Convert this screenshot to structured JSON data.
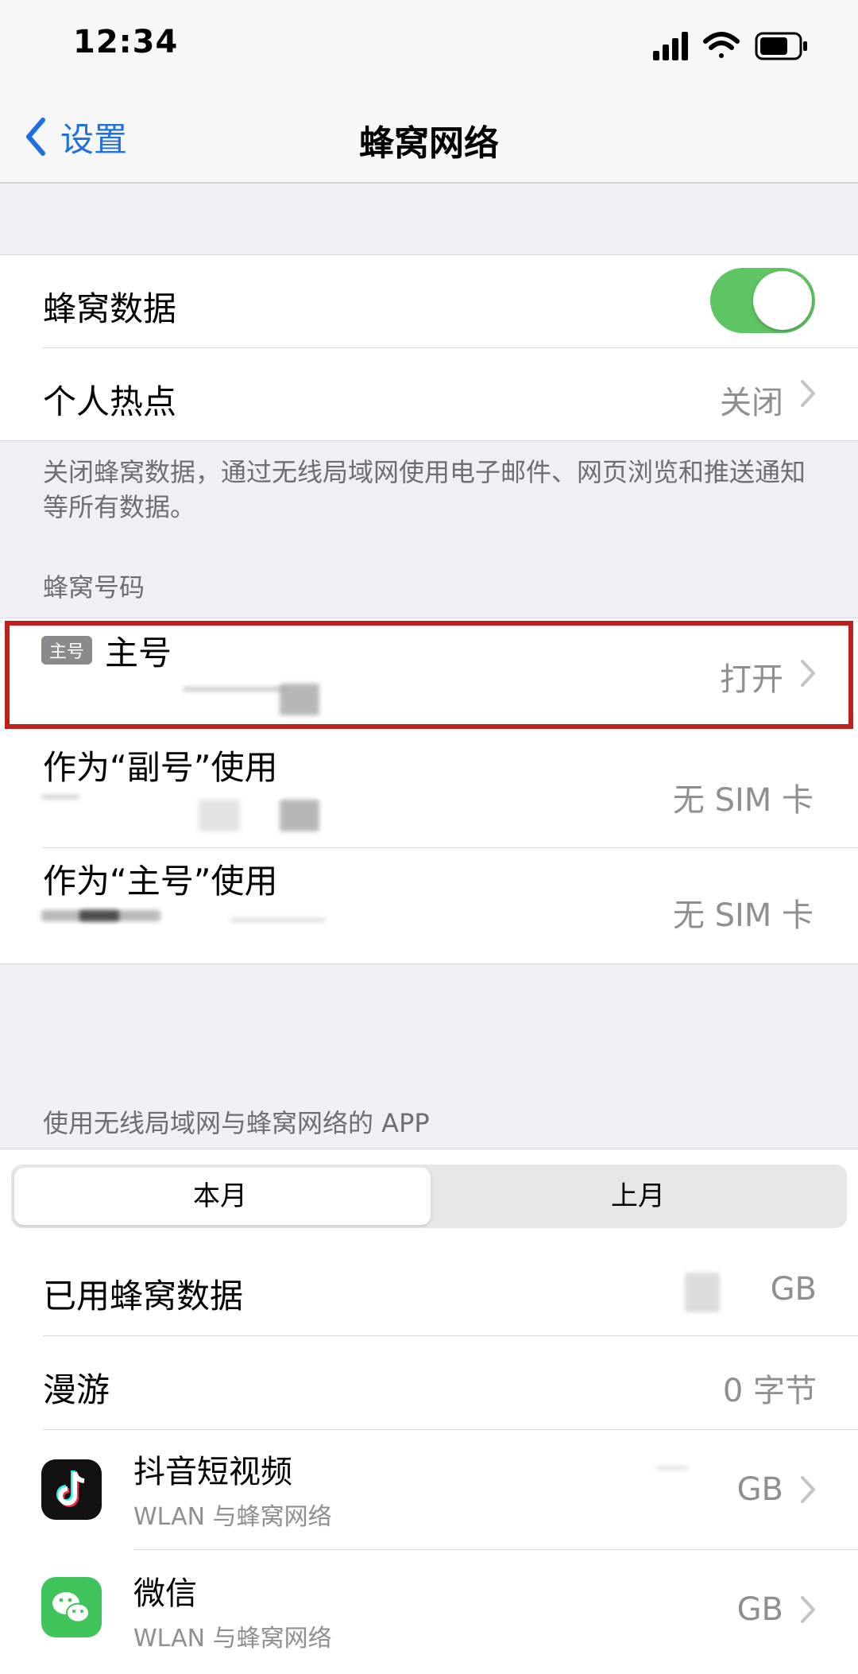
{
  "status_bar": {
    "time": "12:34"
  },
  "nav": {
    "back_label": "设置",
    "title": "蜂窝网络"
  },
  "group1": {
    "cellular_data_label": "蜂窝数据",
    "cellular_data_on": true,
    "hotspot_label": "个人热点",
    "hotspot_value": "关闭"
  },
  "footnote": "关闭蜂窝数据，通过无线局域网使用电子邮件、网页浏览和推送通知等所有数据。",
  "numbers_section": {
    "header": "蜂窝号码",
    "primary": {
      "badge": "主号",
      "label": "主号",
      "value": "打开"
    },
    "as_secondary": {
      "label": "作为“副号”使用",
      "value": "无 SIM 卡"
    },
    "as_primary": {
      "label": "作为“主号”使用",
      "value": "无 SIM 卡"
    }
  },
  "apps_section": {
    "header": "使用无线局域网与蜂窝网络的 APP",
    "segments": [
      "本月",
      "上月"
    ],
    "selected_segment": 0,
    "used_label": "已用蜂窝数据",
    "used_value": "GB",
    "roaming_label": "漫游",
    "roaming_value": "0 字节",
    "apps": [
      {
        "name": "抖音短视频",
        "sub": "WLAN 与蜂窝网络",
        "value": "GB",
        "icon": "tiktok-icon"
      },
      {
        "name": "微信",
        "sub": "WLAN 与蜂窝网络",
        "value": "GB",
        "icon": "wechat-icon"
      }
    ]
  },
  "colors": {
    "accent": "#1f6fe0",
    "toggle_on": "#5fc463",
    "highlight": "#c0201b"
  }
}
